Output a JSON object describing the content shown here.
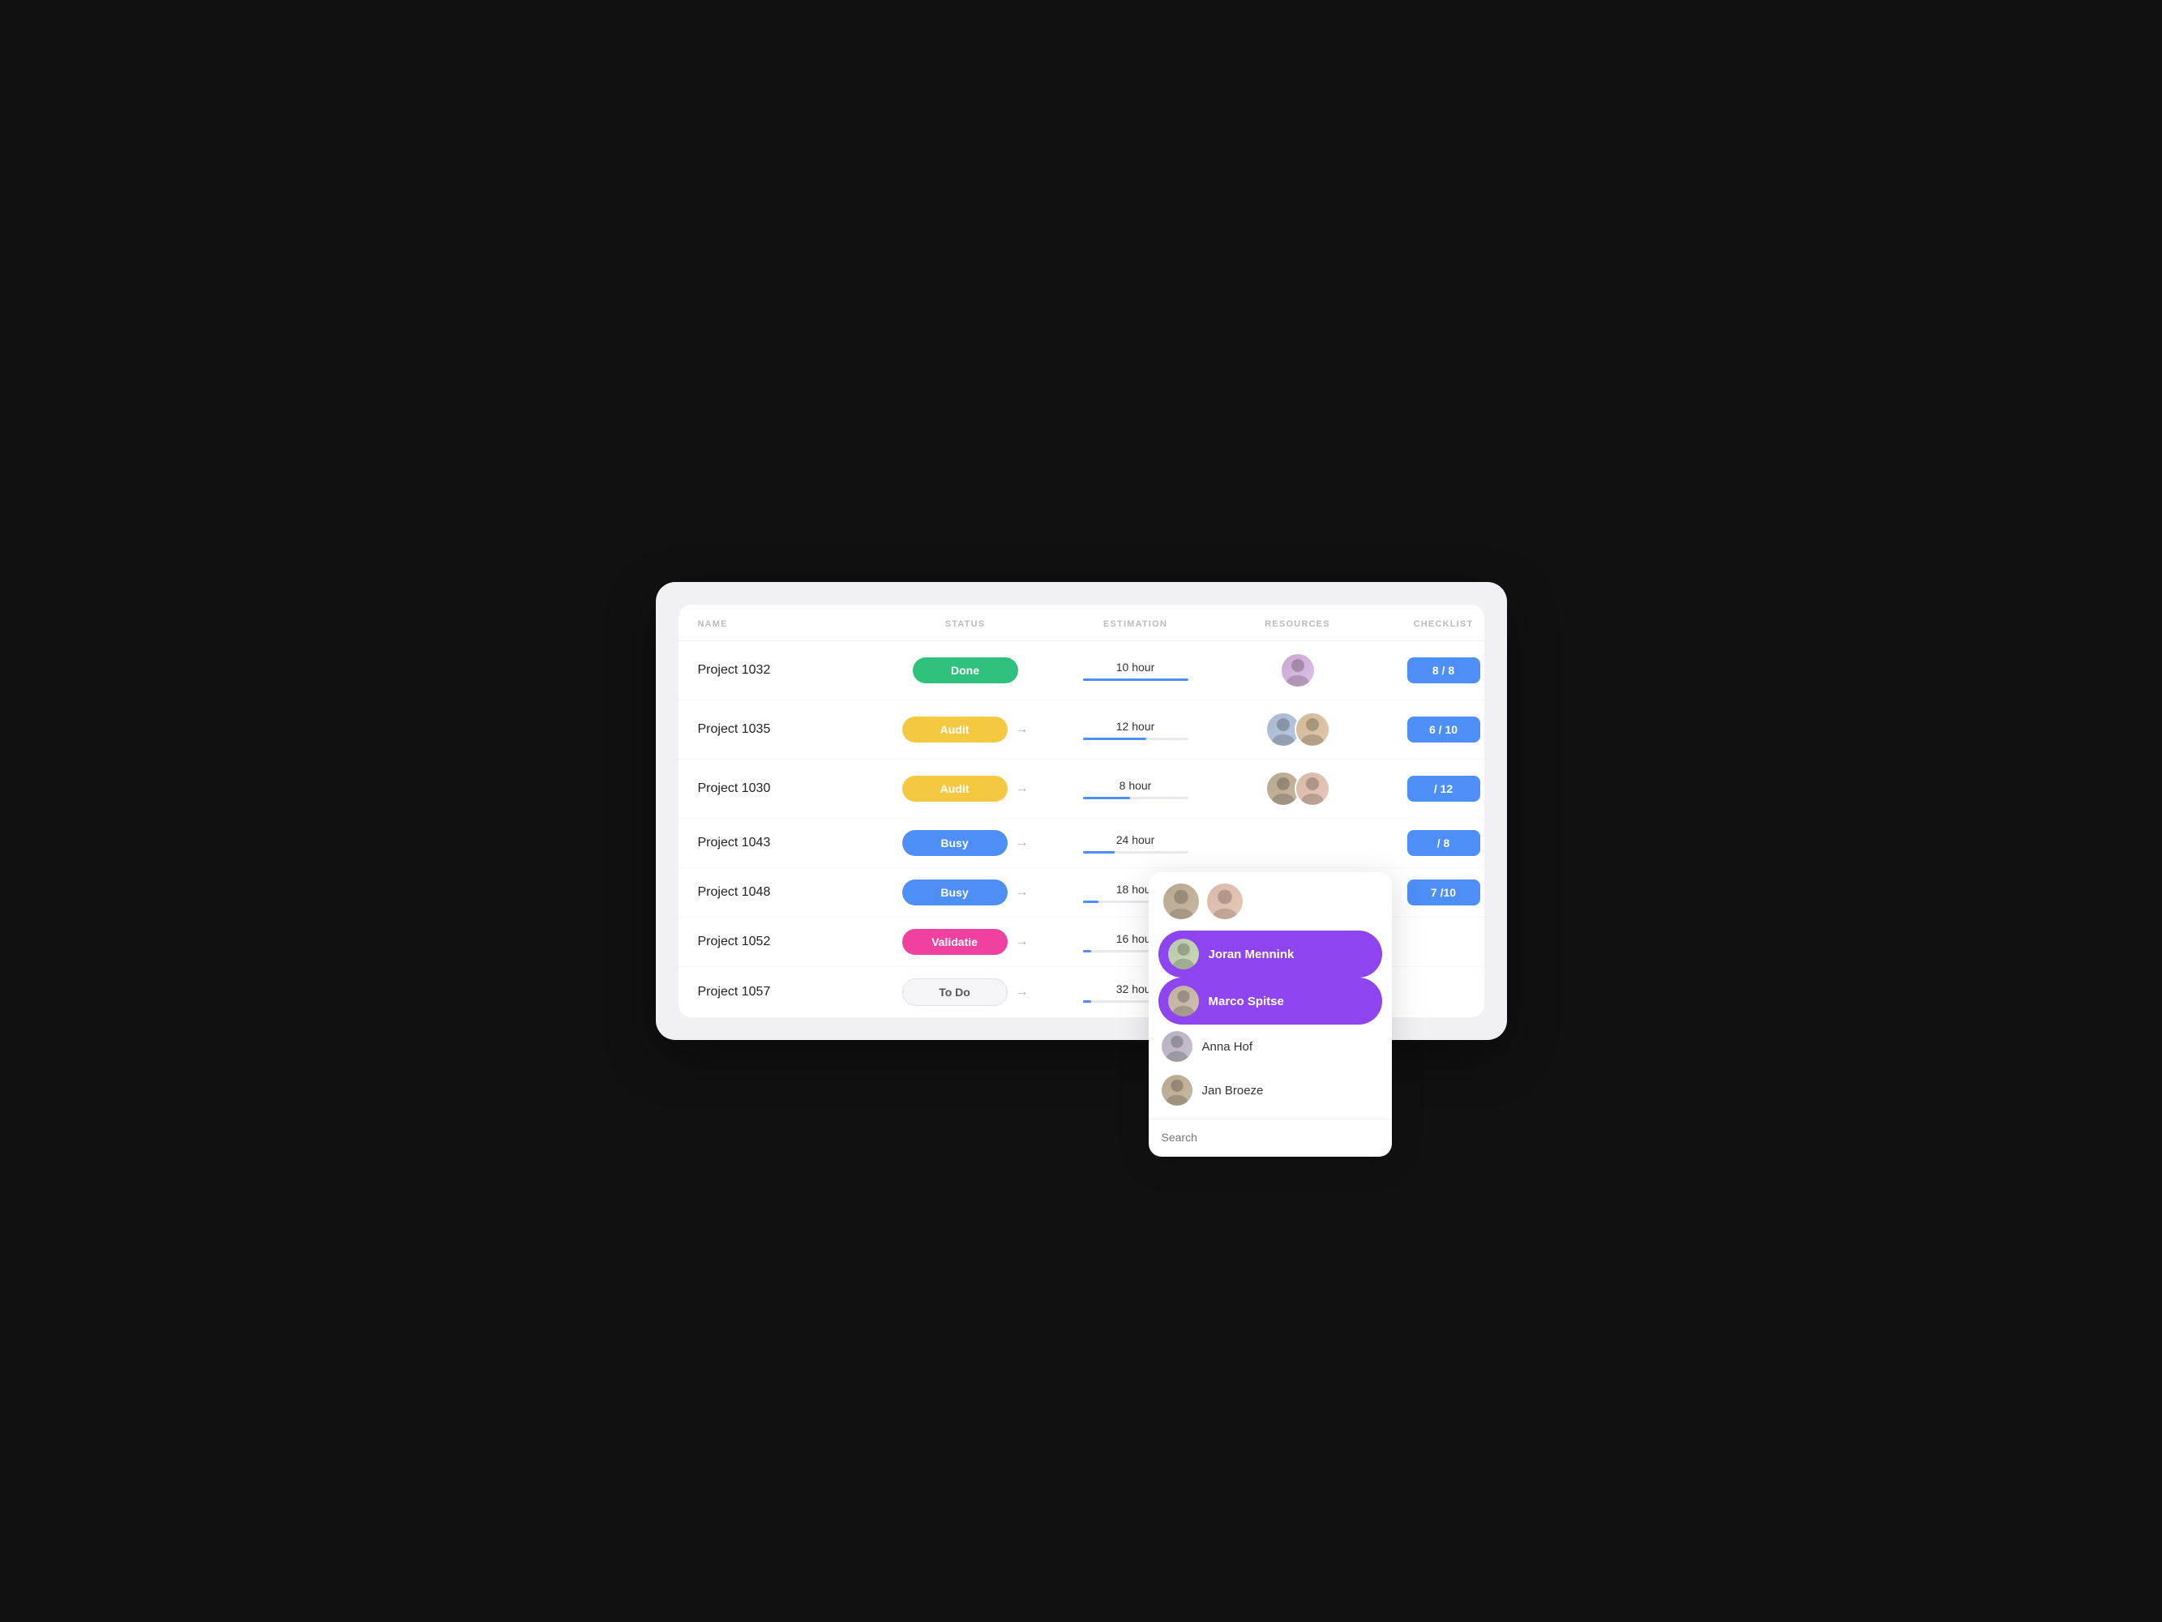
{
  "table": {
    "headers": [
      "NAME",
      "STATUS",
      "ESTIMATION",
      "RESOURCES",
      "CHECKLIST"
    ],
    "rows": [
      {
        "id": "row-1032",
        "name": "Project 1032",
        "status": "Done",
        "status_type": "done",
        "estimation": "10 hour",
        "progress": 100,
        "checklist": "8 / 8",
        "avatars": [
          "av-1"
        ]
      },
      {
        "id": "row-1035",
        "name": "Project 1035",
        "status": "Audit",
        "status_type": "audit",
        "estimation": "12 hour",
        "progress": 60,
        "checklist": "6 / 10",
        "avatars": [
          "av-2",
          "av-3"
        ]
      },
      {
        "id": "row-1030",
        "name": "Project 1030",
        "status": "Audit",
        "status_type": "audit",
        "estimation": "8 hour",
        "progress": 45,
        "checklist": "/ 12",
        "avatars": [
          "av-4",
          "av-5"
        ]
      },
      {
        "id": "row-1043",
        "name": "Project 1043",
        "status": "Busy",
        "status_type": "busy",
        "estimation": "24 hour",
        "progress": 30,
        "checklist": "/ 8",
        "avatars": []
      },
      {
        "id": "row-1048",
        "name": "Project 1048",
        "status": "Busy",
        "status_type": "busy",
        "estimation": "18 hour",
        "progress": 15,
        "checklist": "7 /10",
        "avatars": []
      },
      {
        "id": "row-1052",
        "name": "Project 1052",
        "status": "Validatie",
        "status_type": "validatie",
        "estimation": "16 hour",
        "progress": 0,
        "checklist": "",
        "avatars": []
      },
      {
        "id": "row-1057",
        "name": "Project 1057",
        "status": "To Do",
        "status_type": "todo",
        "estimation": "32 hour",
        "progress": 0,
        "checklist": "",
        "avatars": []
      }
    ]
  },
  "dropdown": {
    "top_avatars": [
      "av-4",
      "av-5"
    ],
    "items": [
      {
        "name": "Joran Mennink",
        "selected": true,
        "av": "av-6"
      },
      {
        "name": "Marco Spitse",
        "selected": true,
        "av": "av-7"
      },
      {
        "name": "Anna Hof",
        "selected": false,
        "av": "av-8"
      },
      {
        "name": "Jan Broeze",
        "selected": false,
        "av": "av-4"
      }
    ],
    "search_placeholder": "Search"
  }
}
